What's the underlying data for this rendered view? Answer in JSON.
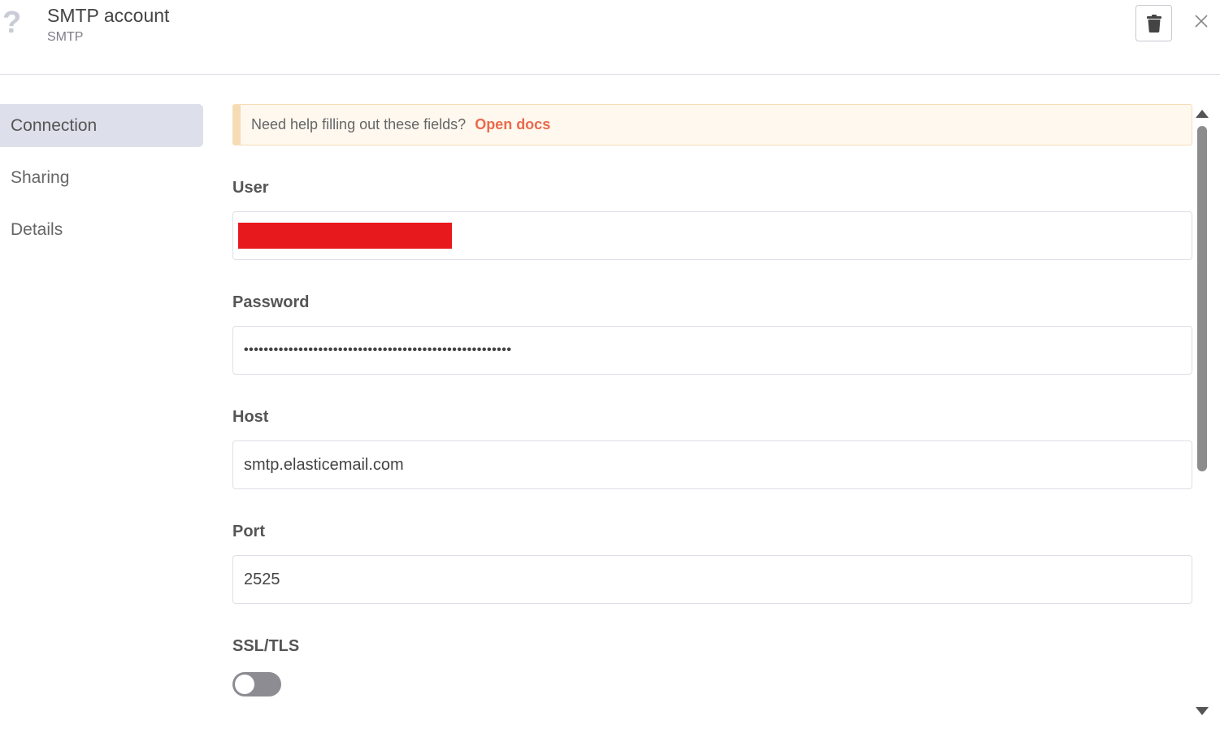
{
  "header": {
    "icon": "question-mark-icon",
    "icon_glyph": "?",
    "title": "SMTP account",
    "subtitle": "SMTP"
  },
  "sidebar": {
    "items": [
      {
        "label": "Connection",
        "active": true
      },
      {
        "label": "Sharing",
        "active": false
      },
      {
        "label": "Details",
        "active": false
      }
    ]
  },
  "notice": {
    "text": "Need help filling out these fields?",
    "link": "Open docs"
  },
  "fields": {
    "user": {
      "label": "User",
      "value": ""
    },
    "password": {
      "label": "Password",
      "value": "••••••••••••••••••••••••••••••••••••••••••••••••••••••"
    },
    "host": {
      "label": "Host",
      "value": "smtp.elasticemail.com"
    },
    "port": {
      "label": "Port",
      "value": "2525"
    },
    "ssl": {
      "label": "SSL/TLS",
      "enabled": false
    }
  },
  "colors": {
    "accent_link": "#ea6a4b",
    "redaction": "#e8191c",
    "sidebar_active": "#dde0ea",
    "notice_bg": "#fef8ef"
  }
}
